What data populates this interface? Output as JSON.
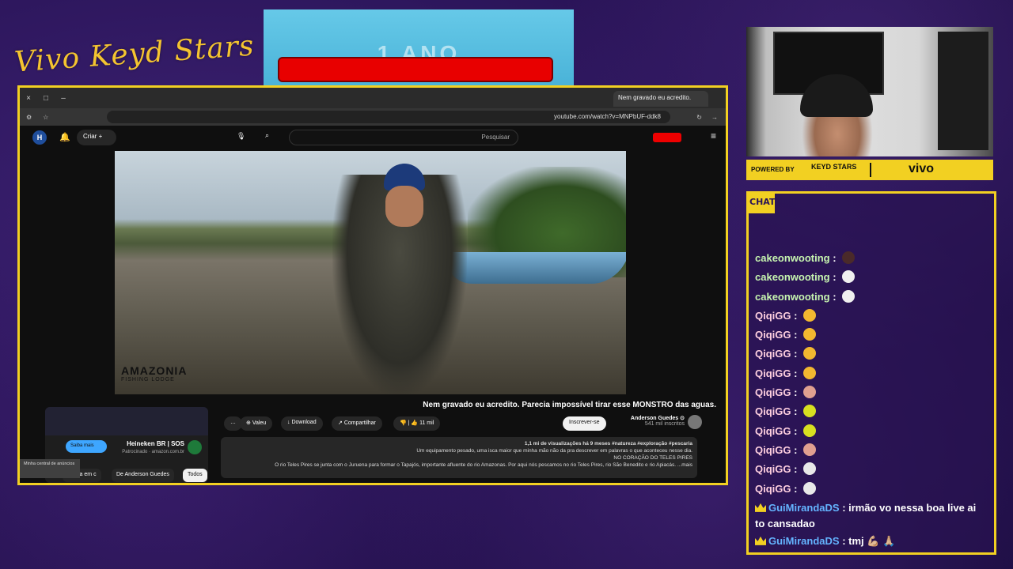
{
  "overlay": {
    "logo_text": "Vivo Keyd Stars",
    "promo_text": "1 ANO",
    "powered_by": "POWERED BY",
    "sponsor_brand": "KEYD STARS",
    "sponsor_vivo": "vivo",
    "chat_tag": "CHAT",
    "colors": {
      "accent": "#f2d022",
      "background": "#2a1458",
      "promo_red": "#e80000"
    }
  },
  "browser": {
    "tab_title": "Nem gravado eu acredito.",
    "url": "youtube.com/watch?v=MNPbUF-ddk8",
    "window_controls": [
      "×",
      "□",
      "–"
    ]
  },
  "youtube": {
    "search_placeholder": "Pesquisar",
    "create_label": "Criar",
    "video_title": "Nem gravado eu acredito. Parecia impossível tirar esse MONSTRO das aguas.",
    "watermark_title": "AMAZONIA",
    "watermark_sub": "FISHING LODGE",
    "channel_name": "Anderson Guedes ⊙",
    "channel_subs": "541 mil inscritos",
    "subscribe_label": "Inscrever-se",
    "like_count": "11 mil",
    "share_label": "Compartilhar",
    "download_label": "Download",
    "thanks_label": "Valeu",
    "more_label": "…",
    "description": {
      "stats": "1,1 mi de visualizações  há 9 meses  #natureza #exploração #pescaria",
      "line1": "Um equipamento pesado, uma isca maior que minha mão não da pra descrever em palavras o que aconteceu nesse dia.",
      "line2": "NO CORAÇÃO DO TELES PIRES",
      "line3": "O rio Teles Pires se junta com o Juruena para formar o Tapajós, importante afluente do rio Amazonas. Por aqui nós pescamos no rio Teles Pires, rio São Benedito e rio Apiacás. ...mais"
    },
    "ad": {
      "title": "Heineken BR | SOS",
      "sponsored": "Patrocinado · amazon.com.br",
      "button": "Saiba mais"
    },
    "chips": [
      "Todos",
      "De Anderson Guedes",
      "Pesca em c"
    ],
    "tooltip": "Minha central de anúncios"
  },
  "chat": {
    "messages": [
      {
        "user": "cakeonwooting",
        "color": "green",
        "emote": "#4a2a2a",
        "text": ""
      },
      {
        "user": "cakeonwooting",
        "color": "green",
        "emote": "#f0f0f0",
        "text": ""
      },
      {
        "user": "cakeonwooting",
        "color": "green",
        "emote": "#f0f0f0",
        "text": ""
      },
      {
        "user": "QiqiGG",
        "color": "pink",
        "emote": "#f2b830",
        "text": ""
      },
      {
        "user": "QiqiGG",
        "color": "pink",
        "emote": "#f2b830",
        "text": ""
      },
      {
        "user": "QiqiGG",
        "color": "pink",
        "emote": "#f2b830",
        "text": ""
      },
      {
        "user": "QiqiGG",
        "color": "pink",
        "emote": "#f2b830",
        "text": ""
      },
      {
        "user": "QiqiGG",
        "color": "pink",
        "emote": "#e0a090",
        "text": ""
      },
      {
        "user": "QiqiGG",
        "color": "pink",
        "emote": "#d8e020",
        "text": ""
      },
      {
        "user": "QiqiGG",
        "color": "pink",
        "emote": "#d8e020",
        "text": ""
      },
      {
        "user": "QiqiGG",
        "color": "pink",
        "emote": "#e0a090",
        "text": ""
      },
      {
        "user": "QiqiGG",
        "color": "pink",
        "emote": "#e8e8e8",
        "text": ""
      },
      {
        "user": "QiqiGG",
        "color": "pink",
        "emote": "#e8e8e8",
        "text": ""
      }
    ],
    "long_messages": [
      {
        "user": "GuiMirandaDS",
        "text": "irmão vo nessa boa live ai to cansadao"
      },
      {
        "user": "GuiMirandaDS",
        "text": "tmj 💪🏼 🙏🏼"
      }
    ]
  }
}
